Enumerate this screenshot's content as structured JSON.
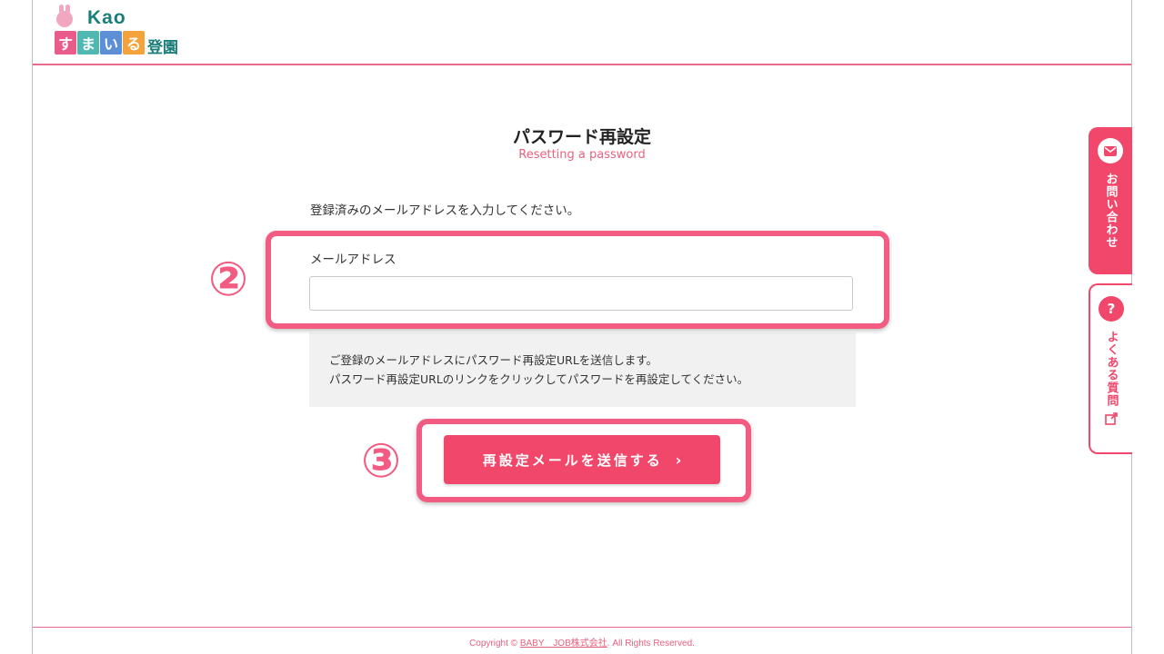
{
  "header": {
    "logo": {
      "brand": "Kao",
      "blocks": [
        "す",
        "ま",
        "い",
        "る"
      ],
      "suffix": "登園"
    }
  },
  "main": {
    "title": "パスワード再設定",
    "subtitle": "Resetting a password",
    "instruction": "登録済みのメールアドレスを入力してください。",
    "email_label": "メールアドレス",
    "email_value": "",
    "email_placeholder": "",
    "info_lines": [
      "ご登録のメールアドレスにパスワード再設定URLを送信します。",
      "パスワード再設定URLのリンクをクリックしてパスワードを再設定してください。"
    ],
    "send_button_label": "再設定メールを送信する",
    "send_button_chevron": "›"
  },
  "annotations": {
    "step2": "②",
    "step3": "③",
    "highlight_color": "#f25c82"
  },
  "side_tabs": {
    "contact": {
      "label": "お問い合わせ",
      "icon": "mail-icon"
    },
    "faq": {
      "label": "よくある質問",
      "icon": "question-icon",
      "external_icon": "external-link-icon"
    }
  },
  "footer": {
    "prefix": "Copyright © ",
    "company": "BABY　JOB株式会社",
    "suffix": ". All Rights Reserved."
  },
  "colors": {
    "accent": "#f0476a",
    "brand_teal": "#1a7f7a",
    "subtitle_pink": "#e8617f"
  }
}
